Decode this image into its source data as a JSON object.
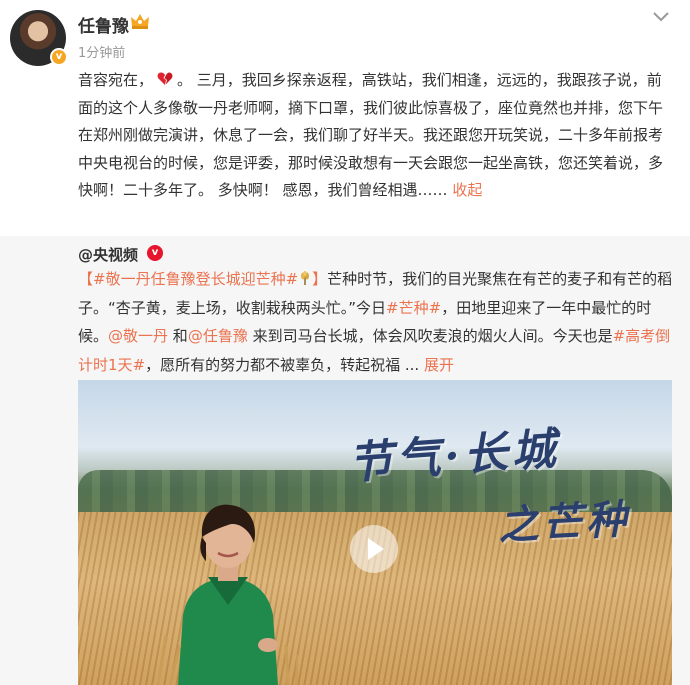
{
  "author": {
    "name": "任鲁豫",
    "timestamp": "1分钟前",
    "avatar_icon": "avatar-photo",
    "badge_icon": "crown-icon"
  },
  "post": {
    "text_part1": "音容宛在，",
    "text_part2": "。 三月，我回乡探亲返程，高铁站，我们相逢，远远的，我跟孩子说，前面的这个人多像敬一丹老师啊，摘下口罩，我们彼此惊喜极了，座位竟然也并排，您下午在郑州刚做完演讲，休息了一会，我们聊了好半天。我还跟您开玩笑说，二十多年前报考中央电视台的时候，您是评委，那时候没敢想有一天会跟您一起坐高铁，您还笑着说，多快啊！二十多年了。 多快啊！ 感恩，我们曾经相遇……",
    "collapse_label": "收起",
    "heart_icon": "broken-heart-icon"
  },
  "repost": {
    "author": "@央视频",
    "verified_icon": "red-v-icon",
    "bracket_open": "【",
    "topic_main": "#敬一丹任鲁豫登长城迎芒种#",
    "bracket_close": "】",
    "text1": "芒种时节，我们的目光聚焦在有芒的麦子和有芒的稻子。“杏子黄，麦上场，收割栽秧两头忙。”今日",
    "topic_mangzhong": "#芒种#",
    "text2": "，田地里迎来了一年中最忙的时候。",
    "mention1": "@敬一丹",
    "text3": " 和",
    "mention2": "@任鲁豫",
    "text4": " 来到司马台长城，体会风吹麦浪的烟火人间。今天也是",
    "topic_gaokao": "#高考倒计时1天#",
    "text5": "，愿所有的努力都不被辜负，转起祝福 ... ",
    "expand_label": "展开"
  },
  "video": {
    "calligraphy_line1": "节气·长城",
    "calligraphy_line2": "之芒种",
    "play_icon": "play-icon"
  },
  "colors": {
    "accent": "#eb7350",
    "verified_red": "#e6162d",
    "badge_orange": "#f5a623"
  }
}
